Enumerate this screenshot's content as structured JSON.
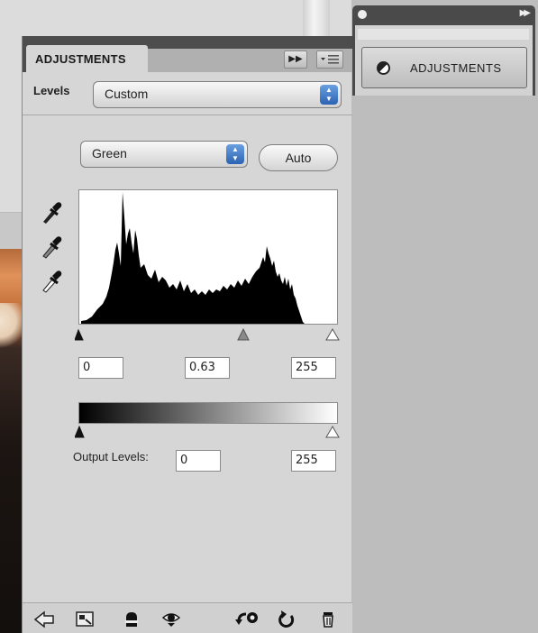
{
  "dock": {
    "button_label": "ADJUSTMENTS",
    "expand_icon": "double-chevron-right-icon"
  },
  "panel": {
    "tab_title": "ADJUSTMENTS",
    "collapse_icon": "double-chevron-right-icon",
    "menu_icon": "panel-menu-icon",
    "preset_label": "Levels",
    "preset_value": "Custom",
    "channel_value": "Green",
    "auto_label": "Auto",
    "eyedroppers": [
      "black-point-eyedropper-icon",
      "gray-point-eyedropper-icon",
      "white-point-eyedropper-icon"
    ],
    "input_levels": {
      "black": "0",
      "gamma": "0.63",
      "white": "255",
      "black_slider_value": 0,
      "gamma_slider_value": 0.63,
      "white_slider_value": 255
    },
    "output_levels": {
      "label": "Output Levels:",
      "black": "0",
      "white": "255"
    },
    "bottom_icons": [
      "return-to-list-icon",
      "expanded-view-icon",
      "clip-to-layer-icon",
      "visibility-eye-icon",
      "view-previous-state-icon",
      "reset-icon",
      "delete-icon"
    ]
  },
  "colors": {
    "selector_accent": "#2c63b3",
    "panel_header": "#4d4d4d",
    "panel_body": "#d6d6d6"
  }
}
